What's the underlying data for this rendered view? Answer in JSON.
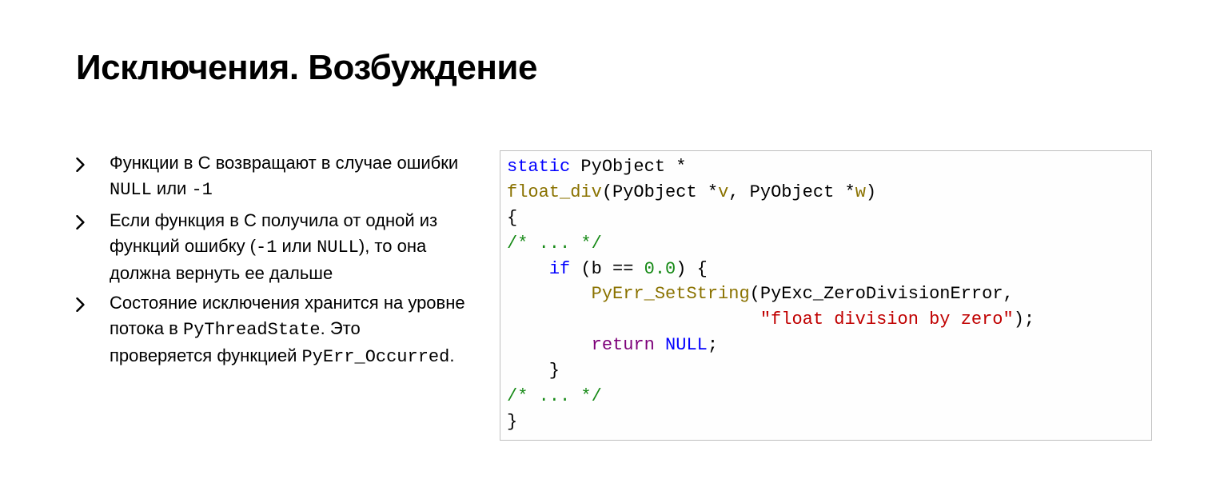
{
  "title": "Исключения. Возбуждение",
  "bullets": [
    {
      "segments": [
        {
          "t": "Функции в C возвращают в случае ошибки "
        },
        {
          "t": "NULL",
          "mono": true
        },
        {
          "t": " или "
        },
        {
          "t": "-1",
          "mono": true
        }
      ]
    },
    {
      "segments": [
        {
          "t": "Если функция в C получила от одной из функций ошибку ("
        },
        {
          "t": "-1",
          "mono": true
        },
        {
          "t": " или "
        },
        {
          "t": "NULL",
          "mono": true
        },
        {
          "t": "), то она должна вернуть ее дальше"
        }
      ]
    },
    {
      "segments": [
        {
          "t": "Состояние исключения хранится на уровне потока в "
        },
        {
          "t": "PyThreadState",
          "mono": true
        },
        {
          "t": ". Это проверяется функцией "
        },
        {
          "t": "PyErr_Occurred",
          "mono": true
        },
        {
          "t": "."
        }
      ]
    }
  ],
  "code": [
    [
      {
        "t": "static",
        "c": "tok-kw"
      },
      {
        "t": " PyObject *"
      }
    ],
    [
      {
        "t": "float_div",
        "c": "tok-fn"
      },
      {
        "t": "(PyObject *"
      },
      {
        "t": "v",
        "c": "tok-fn"
      },
      {
        "t": ", PyObject *"
      },
      {
        "t": "w",
        "c": "tok-fn"
      },
      {
        "t": ")"
      }
    ],
    [
      {
        "t": "{"
      }
    ],
    [
      {
        "t": "/* ... */",
        "c": "tok-cm"
      }
    ],
    [
      {
        "t": "    "
      },
      {
        "t": "if",
        "c": "tok-kw"
      },
      {
        "t": " (b == "
      },
      {
        "t": "0.0",
        "c": "tok-lit"
      },
      {
        "t": ") {"
      }
    ],
    [
      {
        "t": "        "
      },
      {
        "t": "PyErr_SetString",
        "c": "tok-fn"
      },
      {
        "t": "(PyExc_ZeroDivisionError,"
      }
    ],
    [
      {
        "t": "                        "
      },
      {
        "t": "\"float division by zero\"",
        "c": "tok-str"
      },
      {
        "t": ");"
      }
    ],
    [
      {
        "t": "        "
      },
      {
        "t": "return",
        "c": "tok-ret"
      },
      {
        "t": " "
      },
      {
        "t": "NULL",
        "c": "tok-null"
      },
      {
        "t": ";"
      }
    ],
    [
      {
        "t": "    }"
      }
    ],
    [
      {
        "t": "/* ... */",
        "c": "tok-cm"
      }
    ],
    [
      {
        "t": "}"
      }
    ]
  ]
}
